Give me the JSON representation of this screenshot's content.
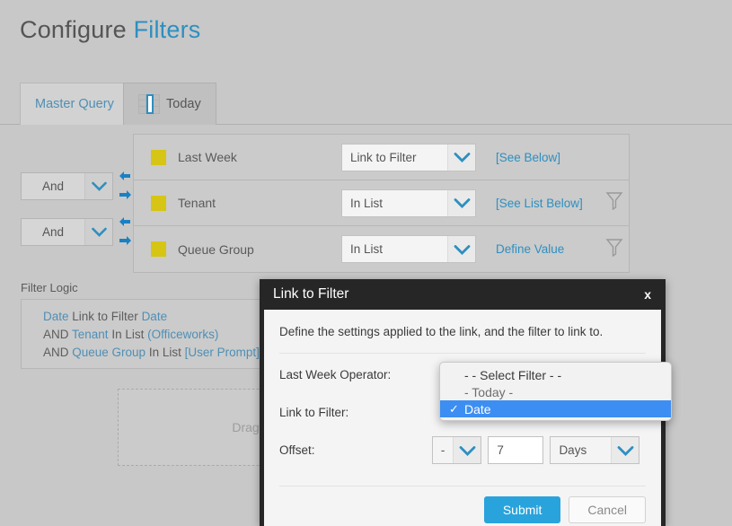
{
  "page": {
    "title_prefix": "Configure",
    "title_accent": "Filters"
  },
  "tabs": [
    {
      "label": "Master Query",
      "icon": "",
      "active": false
    },
    {
      "label": "Today",
      "icon": "table-grid-icon",
      "active": true
    }
  ],
  "logic_column": [
    {
      "value": "And",
      "arrow_left": "arrow-left-icon",
      "arrow_right": "arrow-right-icon"
    },
    {
      "value": "And",
      "arrow_left": "arrow-left-icon",
      "arrow_right": "arrow-right-icon"
    }
  ],
  "filter_rows": [
    {
      "swatch_color": "#d6c514",
      "field": "Last Week",
      "operator": "Link to Filter",
      "value": "[See Below]",
      "has_funnel": false
    },
    {
      "swatch_color": "#d6c514",
      "field": "Tenant",
      "operator": "In List",
      "value": "[See List Below]",
      "has_funnel": true,
      "funnel_icon": "funnel-icon"
    },
    {
      "swatch_color": "#d6c514",
      "field": "Queue Group",
      "operator": "In List",
      "value": "Define Value",
      "has_funnel": true,
      "funnel_icon": "funnel-icon"
    }
  ],
  "filter_logic": {
    "label": "Filter Logic",
    "lines": [
      {
        "parts": [
          {
            "t": "Date",
            "blue": true
          },
          {
            "t": " Link to Filter ",
            "blue": false
          },
          {
            "t": "Date",
            "blue": true
          }
        ]
      },
      {
        "parts": [
          {
            "t": "AND ",
            "blue": false
          },
          {
            "t": "Tenant",
            "blue": true
          },
          {
            "t": " In List ",
            "blue": false
          },
          {
            "t": "(Officeworks)",
            "blue": true
          }
        ]
      },
      {
        "parts": [
          {
            "t": "AND ",
            "blue": false
          },
          {
            "t": "Queue Group",
            "blue": true
          },
          {
            "t": " In List ",
            "blue": false
          },
          {
            "t": "[User Prompt]",
            "blue": true
          }
        ]
      }
    ]
  },
  "dropzone": {
    "text": "Drag filter fields"
  },
  "modal": {
    "title": "Link to Filter",
    "close_label": "x",
    "description": "Define the settings applied to the link, and the filter to link to.",
    "fields": {
      "operator_label": "Last Week Operator:",
      "link_label": "Link to Filter:",
      "offset_label": "Offset:",
      "offset_sign": "-",
      "offset_amount": "7",
      "offset_unit": "Days"
    },
    "buttons": {
      "submit": "Submit",
      "cancel": "Cancel"
    },
    "accent_color": "#29a3dc"
  },
  "dropdown": {
    "open": true,
    "options": [
      {
        "label": "- - Select Filter - -",
        "selected": false,
        "muted": false
      },
      {
        "label": "- Today -",
        "selected": false,
        "muted": true
      },
      {
        "label": "Date",
        "selected": true,
        "muted": false
      }
    ],
    "tick_glyph": "✓",
    "highlight_color": "#3d8ef2"
  }
}
